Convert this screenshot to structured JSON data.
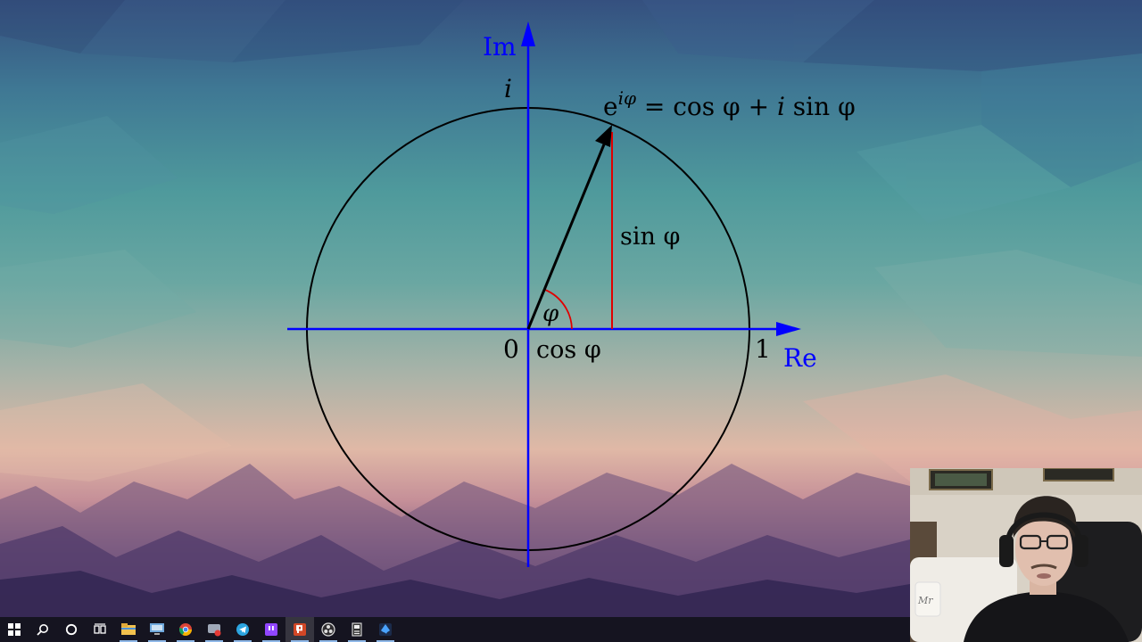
{
  "diagram": {
    "axis_im": "Im",
    "axis_re": "Re",
    "label_i": "i",
    "label_origin": "0",
    "label_one": "1",
    "label_cos": "cos φ",
    "label_sin": "sin φ",
    "label_phi": "φ",
    "formula_base": "e",
    "formula_exponent": "iφ",
    "formula_rhs_1": "= cos φ + ",
    "formula_rhs_i": "i",
    "formula_rhs_2": " sin φ",
    "colors": {
      "axes": "#0000ff",
      "circle": "#000000",
      "vector": "#000000",
      "projection": "#e00000",
      "angle_arc": "#e00000"
    }
  },
  "taskbar": {
    "icons": [
      "windows-start-icon",
      "search-icon",
      "cortana-circle-icon",
      "task-view-icon",
      "file-explorer-icon",
      "remote-desktop-icon",
      "chrome-icon",
      "messenger-icon",
      "telegram-icon",
      "twitch-icon",
      "powerpoint-icon",
      "obs-icon",
      "utility-app-icon",
      "inkscape-icon"
    ]
  },
  "webcam": {
    "cushion_text": "Mr"
  }
}
